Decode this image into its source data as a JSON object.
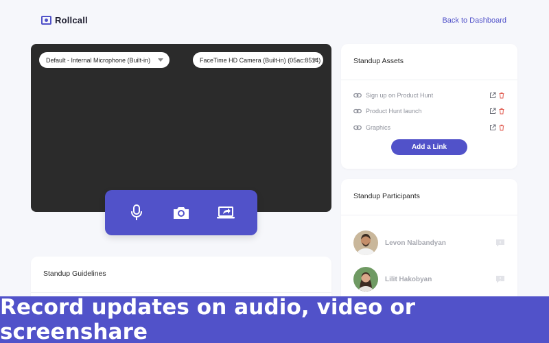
{
  "app": {
    "name": "Rollcall"
  },
  "header": {
    "back_link": "Back to Dashboard"
  },
  "devices": {
    "microphone": "Default - Internal Microphone (Built-in)",
    "camera": "FaceTime HD Camera (Built-in) (05ac:8514)"
  },
  "controls": [
    "microphone-icon",
    "camera-icon",
    "screenshare-icon"
  ],
  "guidelines": {
    "title": "Standup Guidelines"
  },
  "assets": {
    "title": "Standup Assets",
    "items": [
      {
        "label": "Sign up on Product Hunt"
      },
      {
        "label": "Product Hunt launch"
      },
      {
        "label": "Graphics"
      }
    ],
    "add_button": "Add a Link"
  },
  "participants": {
    "title": "Standup Participants",
    "items": [
      {
        "name": "Levon Nalbandyan"
      },
      {
        "name": "Lilit Hakobyan"
      }
    ]
  },
  "banner": {
    "text": "Record updates on audio, video or screenshare"
  },
  "colors": {
    "accent": "#5152C9",
    "delete": "#E05A4F",
    "video_bg": "#2B2B2B"
  }
}
